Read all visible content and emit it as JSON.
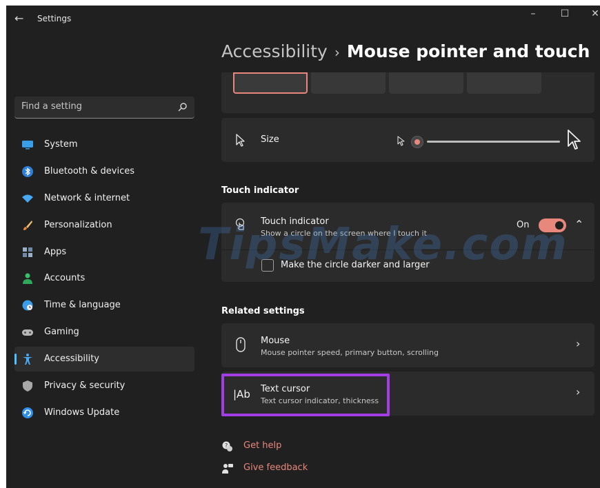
{
  "window": {
    "title": "Settings"
  },
  "search": {
    "placeholder": "Find a setting"
  },
  "sidebar": {
    "items": [
      {
        "label": "System",
        "icon": "monitor-icon",
        "active": false
      },
      {
        "label": "Bluetooth & devices",
        "icon": "bluetooth-icon",
        "active": false
      },
      {
        "label": "Network & internet",
        "icon": "wifi-icon",
        "active": false
      },
      {
        "label": "Personalization",
        "icon": "brush-icon",
        "active": false
      },
      {
        "label": "Apps",
        "icon": "apps-icon",
        "active": false
      },
      {
        "label": "Accounts",
        "icon": "person-icon",
        "active": false
      },
      {
        "label": "Time & language",
        "icon": "globe-clock-icon",
        "active": false
      },
      {
        "label": "Gaming",
        "icon": "gamepad-icon",
        "active": false
      },
      {
        "label": "Accessibility",
        "icon": "accessibility-icon",
        "active": true
      },
      {
        "label": "Privacy & security",
        "icon": "shield-icon",
        "active": false
      },
      {
        "label": "Windows Update",
        "icon": "update-icon",
        "active": false
      }
    ]
  },
  "breadcrumb": {
    "parent": "Accessibility",
    "separator": "›",
    "current": "Mouse pointer and touch"
  },
  "pointer_style": {
    "selected_index": 0,
    "options": 4
  },
  "size": {
    "label": "Size",
    "value": 0.04
  },
  "touch_section": {
    "title": "Touch indicator"
  },
  "touch_indicator": {
    "title": "Touch indicator",
    "subtitle": "Show a circle on the screen where I touch it",
    "state_label": "On",
    "on": true,
    "checkbox_label": "Make the circle darker and larger",
    "checkbox_checked": false
  },
  "related": {
    "title": "Related settings"
  },
  "mouse": {
    "title": "Mouse",
    "subtitle": "Mouse pointer speed, primary button, scrolling"
  },
  "text_cursor": {
    "title": "Text cursor",
    "subtitle": "Text cursor indicator, thickness",
    "icon_text": "|Ab"
  },
  "links": {
    "help": "Get help",
    "feedback": "Give feedback"
  },
  "watermark": {
    "text": "TipsMake.com"
  },
  "colors": {
    "accent": "#e8877c",
    "highlight": "#a23ee6",
    "active_indicator": "#4cc2ff",
    "background": "#202020",
    "card": "#2b2b2b"
  }
}
